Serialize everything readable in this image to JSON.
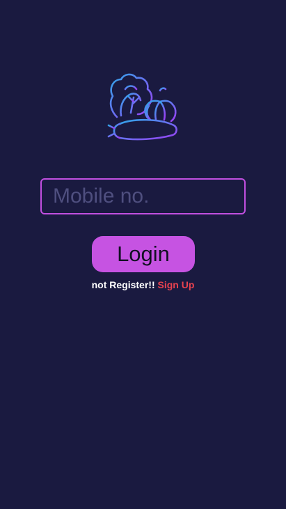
{
  "app": {
    "logo_icon": "vegetables-icon",
    "colors": {
      "background": "#1a1a40",
      "accent": "#c653e2",
      "link": "#e8424f"
    }
  },
  "login_form": {
    "mobile_placeholder": "Mobile no.",
    "mobile_value": "",
    "login_label": "Login",
    "register_prompt": "not Register!!",
    "signup_label": "Sign Up"
  }
}
